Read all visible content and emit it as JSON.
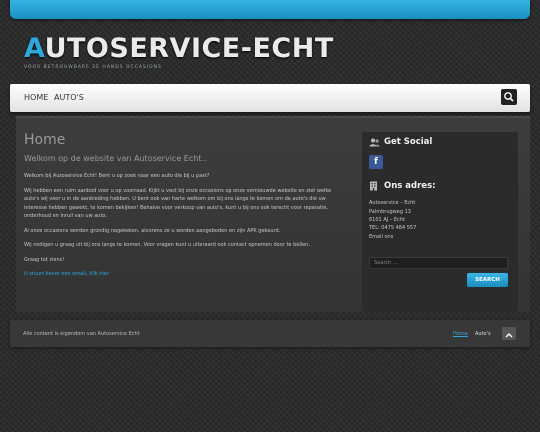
{
  "site": {
    "logo_first_letter": "A",
    "logo_rest": "UTOSERVICE-ECHT",
    "tagline": "VOOR BETROUWBARE 2E HANDS OCCASIONS"
  },
  "nav": {
    "items": [
      "HOME",
      "AUTO'S"
    ]
  },
  "content": {
    "title": "Home",
    "subtitle": "Welkom op de website van Autoservice Echt..",
    "paragraphs": [
      "Welkom bij Autoservice Echt! Bent u op zoek naar een auto die bij u past?",
      "Wij hebben een ruim aanbod voor u op voorraad. Kijkt u vast bij onze occasions op onze vernieuwde website en ziet welke auto's wij voor u in de aanbieding hebben. U bent ook van harte welkom om bij ons langs te komen om de auto's die uw interesse hebben gewekt, te komen bekijken! Behalve voor verkoop van auto's, kunt u bij ons ook terecht voor reparatie, onderhoud en inruil van uw auto.",
      "Al onze occasions worden grondig nagekeken, alvorens ze u worden aangeboden en zijn APK gekeurd.",
      "Wij nodigen u graag uit bij ons langs te komen. Voor vragen kunt u uiteraard ook contact opnemen door te bellen.",
      "Graag tot ziens!"
    ],
    "email_link": "U stuurt liever een email, klik hier"
  },
  "sidebar": {
    "social_title": "Get Social",
    "facebook_glyph": "f",
    "address_title": "Ons adres:",
    "address_lines": [
      "Autoservice – Echt",
      "Palmbrugweg 13",
      "6101 AJ – Echt",
      "TEL: 0475 484 557"
    ],
    "email_label": "Email ons",
    "search_placeholder": "Search …",
    "search_button": "SEARCH"
  },
  "footer": {
    "copyright": "Alle content is eigendom van Autoservice Echt",
    "links": [
      "Home",
      "Auto's"
    ]
  },
  "colors": {
    "accent": "#2ea8dc",
    "facebook": "#3b5998"
  },
  "icons": {
    "nav_search": "search-icon",
    "social": "users-icon",
    "address": "building-icon",
    "back_to_top": "chevron-up-icon"
  }
}
